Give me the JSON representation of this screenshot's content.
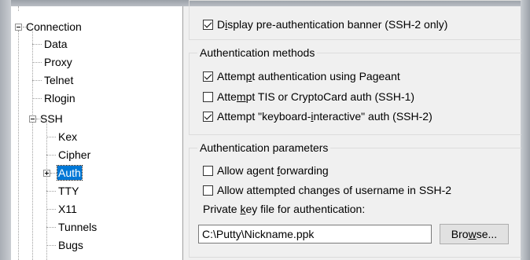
{
  "tree": {
    "connection": "Connection",
    "data": "Data",
    "proxy": "Proxy",
    "telnet": "Telnet",
    "rlogin": "Rlogin",
    "ssh": "SSH",
    "kex": "Kex",
    "cipher": "Cipher",
    "auth": "Auth",
    "tty": "TTY",
    "x11": "X11",
    "tunnels": "Tunnels",
    "bugs": "Bugs",
    "selected": "Auth"
  },
  "banner_option": {
    "label_pre": "D",
    "label_u": "i",
    "label_post": "splay pre-authentication banner (SSH-2 only)",
    "checked": true
  },
  "auth_methods": {
    "title": "Authentication methods",
    "pageant": {
      "pre": "Attem",
      "u": "p",
      "post": "t authentication using Pageant",
      "checked": true
    },
    "tis": {
      "pre": "Atte",
      "u": "m",
      "post": "pt TIS or CryptoCard auth (SSH-1)",
      "checked": false
    },
    "keyboard": {
      "pre": "Attempt \"keyboard-",
      "u": "i",
      "post": "nteractive\" auth (SSH-2)",
      "checked": true
    }
  },
  "auth_params": {
    "title": "Authentication parameters",
    "agent_forwarding": {
      "pre": "Allow agent ",
      "u": "f",
      "post": "orwarding",
      "checked": false
    },
    "username_changes": {
      "pre": "Allow attempted changes of username in SSH-2",
      "checked": false
    },
    "key_label": {
      "pre": "Private ",
      "u": "k",
      "post": "ey file for authentication:"
    },
    "key_value": "C:\\Putty\\Nickname.ppk",
    "browse": {
      "pre": "Bro",
      "u": "w",
      "post": "se..."
    }
  },
  "colors": {
    "selection": "#0078d7",
    "panel": "#f0f0f0"
  }
}
